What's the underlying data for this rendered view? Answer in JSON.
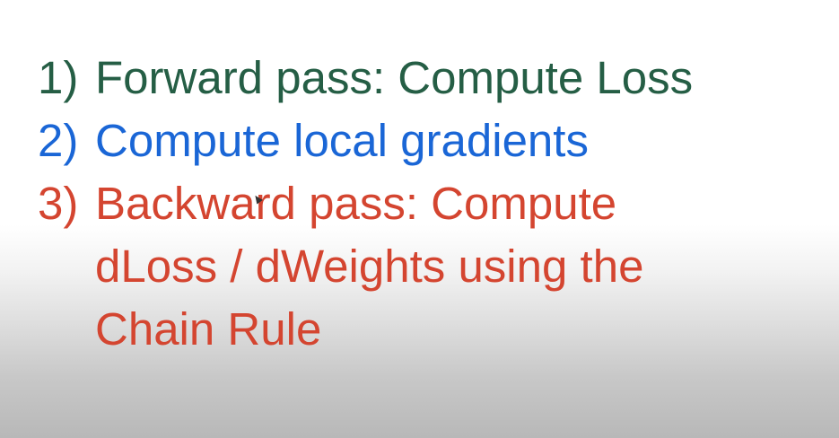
{
  "steps": [
    {
      "number": "1)",
      "text": "Forward pass: Compute Loss",
      "color": "#255e45"
    },
    {
      "number": "2)",
      "text": "Compute local gradients",
      "color": "#1a66d6"
    },
    {
      "number": "3)",
      "text": "Backward pass: Compute",
      "color": "#d44530"
    }
  ],
  "step3_continuation": [
    "dLoss / dWeights using the",
    "Chain Rule"
  ],
  "pointer_icon": "mouse-cursor-icon"
}
